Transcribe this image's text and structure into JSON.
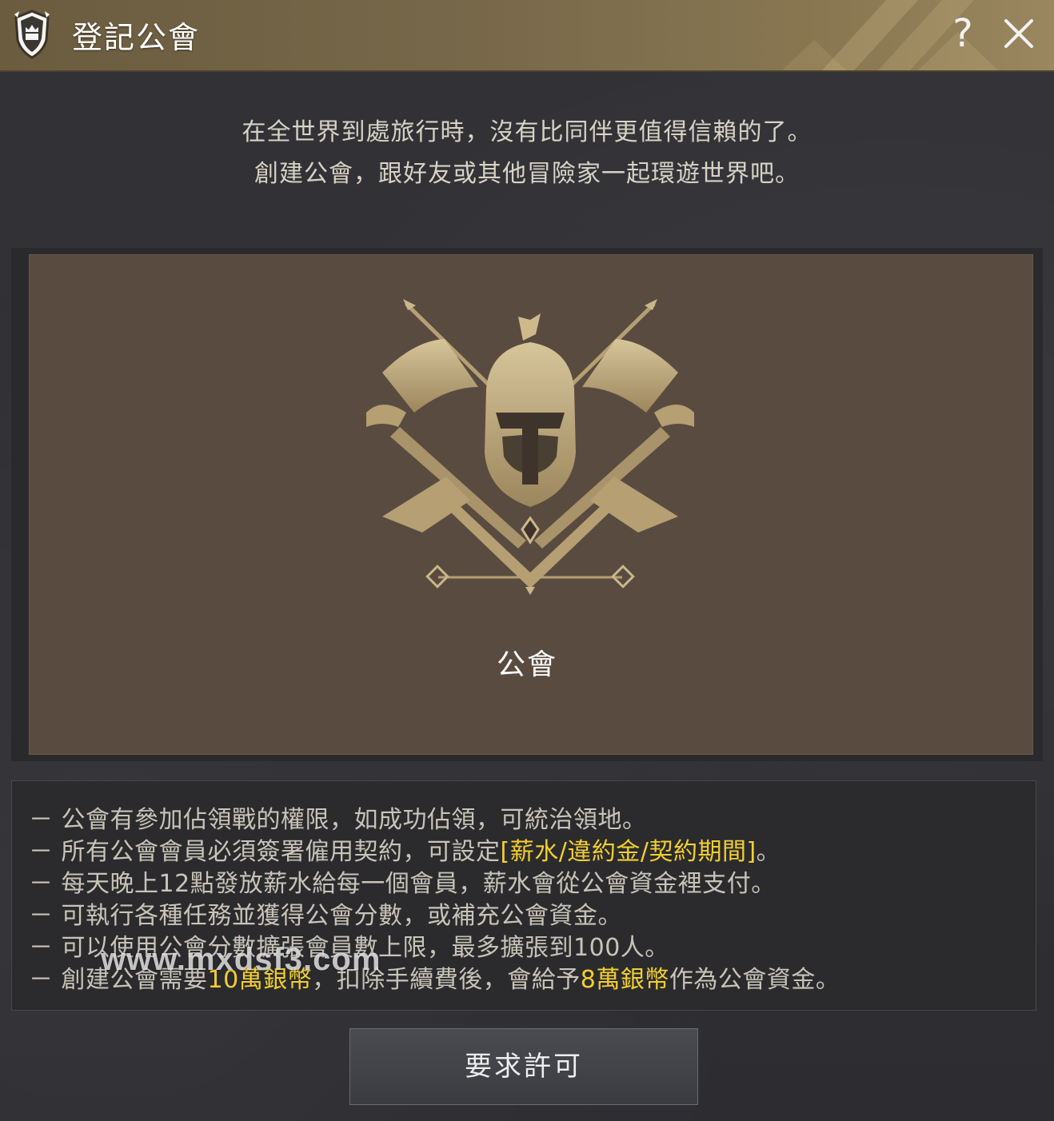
{
  "header": {
    "title": "登記公會",
    "help_label": "?",
    "guild_icon": "guild-shield-icon",
    "close_icon": "close-icon"
  },
  "intro": {
    "line1": "在全世界到處旅行時，沒有比同伴更值得信賴的了。",
    "line2": "創建公會，跟好友或其他冒險家一起環遊世界吧。"
  },
  "emblem": {
    "icon": "guild-warrior-emblem-icon",
    "label": "公會"
  },
  "info": {
    "bullet": "－",
    "line1": "公會有參加佔領戰的權限，如成功佔領，可統治領地。",
    "line2_pre": "所有公會會員必須簽署僱用契約，可設定",
    "line2_hl": "[薪水/違約金/契約期間]",
    "line2_post": "。",
    "line3": "每天晚上12點發放薪水給每一個會員，薪水會從公會資金裡支付。",
    "line4": "可執行各種任務並獲得公會分數，或補充公會資金。",
    "line5": "可以使用公會分數擴張會員數上限，最多擴張到100人。",
    "line6_pre": "創建公會需要",
    "line6_hl1": "10萬銀幣",
    "line6_mid": "，扣除手續費後，會給予",
    "line6_hl2": "8萬銀幣",
    "line6_post": "作為公會資金。"
  },
  "watermark": "www.mxdsf3.com",
  "button": {
    "label": "要求許可"
  },
  "colors": {
    "header_gold": "#78684a",
    "highlight_yellow": "#f2cf2e",
    "panel_brown": "#5a4b40",
    "emblem_gold": "#b59f73"
  }
}
